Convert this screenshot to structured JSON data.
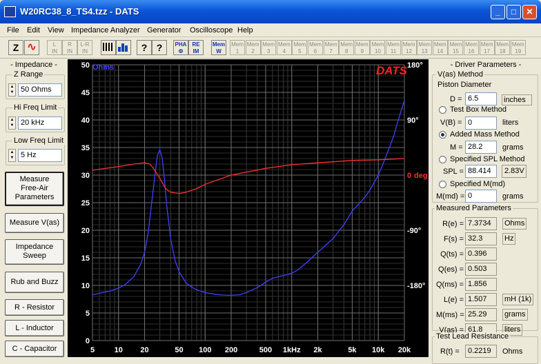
{
  "window": {
    "title": "W20RC38_8_TS4.tzz - DATS",
    "minimize_glyph": "_",
    "maximize_glyph": "□",
    "close_glyph": "✕"
  },
  "menu": [
    "File",
    "Edit",
    "View",
    "Impedance Analyzer",
    "Generator",
    "Oscilloscope",
    "Help"
  ],
  "toolbar": {
    "z_label": "Z",
    "sine_glyph": "∿",
    "trace_buttons": [
      [
        "L",
        "IN"
      ],
      [
        "R",
        "IN"
      ],
      [
        "L-R",
        "IN"
      ]
    ],
    "pha_label": "PHA",
    "pha_sub": "Φ",
    "reim_label": "RE",
    "reim_sub": "IM",
    "mem_label": "Mem",
    "mem_w": "W",
    "mem_slots": [
      "1",
      "2",
      "3",
      "4",
      "5",
      "6",
      "7",
      "8",
      "9",
      "10",
      "11",
      "12",
      "13",
      "14",
      "15",
      "16",
      "17",
      "18",
      "19"
    ],
    "help_glyph": "?",
    "whats_this_glyph": "?"
  },
  "left": {
    "title": "- Impedance -",
    "z_range_label": "Z Range",
    "z_range_value": "50 Ohms",
    "hi_freq_label": "Hi Freq Limit",
    "hi_freq_value": "20 kHz",
    "low_freq_label": "Low Freq Limit",
    "low_freq_value": "5 Hz",
    "buttons": [
      "Measure\nFree-Air\nParameters",
      "Measure V(as)",
      "Impedance\nSweep",
      "Rub and Buzz",
      "R - Resistor",
      "L - Inductor",
      "C - Capacitor"
    ]
  },
  "plot": {
    "brand": "DATS",
    "y_unit": "Ohms",
    "phase_unit": "deg",
    "brand_color": "#ff2020",
    "impedance_color": "#4040ff",
    "phase_color": "#ff3030"
  },
  "chart_data": {
    "type": "line",
    "xlabel": "",
    "ylabel": "Ohms",
    "y2label": "deg",
    "x_scale": "log",
    "xlim": [
      5,
      20000
    ],
    "ylim": [
      0,
      50
    ],
    "y2lim": [
      -270,
      180
    ],
    "grid": true,
    "x_ticks": [
      {
        "v": 5,
        "label": "5"
      },
      {
        "v": 10,
        "label": "10"
      },
      {
        "v": 20,
        "label": "20"
      },
      {
        "v": 50,
        "label": "50"
      },
      {
        "v": 100,
        "label": "100"
      },
      {
        "v": 200,
        "label": "200"
      },
      {
        "v": 500,
        "label": "500"
      },
      {
        "v": 1000,
        "label": "1kHz"
      },
      {
        "v": 2000,
        "label": "2k"
      },
      {
        "v": 5000,
        "label": "5k"
      },
      {
        "v": 10000,
        "label": "10k"
      },
      {
        "v": 20000,
        "label": "20k"
      }
    ],
    "y_ticks": [
      "0",
      "5",
      "10",
      "15",
      "20",
      "25",
      "30",
      "35",
      "40",
      "45",
      "50"
    ],
    "y2_ticks": [
      {
        "v": 180,
        "label": "180°"
      },
      {
        "v": 90,
        "label": "90°"
      },
      {
        "v": 0,
        "label": "0"
      },
      {
        "v": -90,
        "label": "-90°"
      },
      {
        "v": -180,
        "label": "-180°"
      }
    ],
    "series": [
      {
        "name": "",
        "axis": "left",
        "x": [
          5,
          8,
          10,
          12,
          15,
          18,
          20,
          22,
          25,
          28,
          30,
          32,
          34,
          36,
          40,
          45,
          50,
          60,
          70,
          80,
          100,
          130,
          160,
          200,
          250,
          300,
          400,
          500,
          600,
          800,
          1000,
          1200,
          1500,
          2000,
          3000,
          4000,
          5000,
          7000,
          8000,
          10000,
          12000,
          15000,
          17000,
          20000
        ],
        "y": [
          8.3,
          9.0,
          9.5,
          10.2,
          11.6,
          13.8,
          16.0,
          19.5,
          27.0,
          33.5,
          34.6,
          33.0,
          29.0,
          24.5,
          18.5,
          14.5,
          12.5,
          10.5,
          9.7,
          9.2,
          8.7,
          8.4,
          8.25,
          8.2,
          8.3,
          8.7,
          9.6,
          10.6,
          11.3,
          11.8,
          12.2,
          12.9,
          14.2,
          16.0,
          18.5,
          21.0,
          23.5,
          26.0,
          27.3,
          30.0,
          33.0,
          37.0,
          40.0,
          43.5
        ]
      },
      {
        "name": "",
        "axis": "right",
        "x": [
          5,
          10,
          15,
          20,
          23,
          25,
          30,
          35,
          40,
          50,
          60,
          80,
          100,
          200,
          500,
          1000,
          2000,
          5000,
          10000,
          20000
        ],
        "y": [
          8,
          14,
          18,
          20,
          18,
          12,
          -5,
          -22,
          -28,
          -30,
          -28,
          -22,
          -15,
          0,
          11,
          17,
          20,
          24,
          25,
          27
        ]
      }
    ]
  },
  "right": {
    "title": "- Driver Parameters -",
    "vas_method": "V(as) Method",
    "piston_diameter": "Piston Diameter",
    "d_label": "D =",
    "d_value": "6.5",
    "d_unit": "inches",
    "test_box": "Test Box Method",
    "vb_label": "V(B) =",
    "vb_value": "0",
    "vb_unit": "liters",
    "added_mass": "Added Mass Method",
    "m_label": "M =",
    "m_value": "28.2",
    "m_unit": "grams",
    "spec_spl": "Specified SPL Method",
    "spl_label": "SPL =",
    "spl_value": "88.414",
    "spl_volt": "2.83V",
    "spec_mmd": "Specified M(md)",
    "mmd_label": "M(md) =",
    "mmd_value": "0",
    "mmd_unit": "grams",
    "measured_title": "Measured Parameters",
    "params": [
      {
        "label": "R(e) =",
        "value": "7.3734",
        "unit": "Ohms"
      },
      {
        "label": "F(s) =",
        "value": "32.3",
        "unit": "Hz"
      },
      {
        "label": "Q(ts) =",
        "value": "0.396",
        "unit": ""
      },
      {
        "label": "Q(es) =",
        "value": "0.503",
        "unit": ""
      },
      {
        "label": "Q(ms) =",
        "value": "1.856",
        "unit": ""
      },
      {
        "label": "L(e) =",
        "value": "1.507",
        "unit": "mH (1k)"
      },
      {
        "label": "M(ms) =",
        "value": "25.29",
        "unit": "grams"
      },
      {
        "label": "V(as) =",
        "value": "61.8",
        "unit": "liters"
      }
    ],
    "lead_title": "Test Lead Resistance",
    "rt_label": "R(t) =",
    "rt_value": "0.2219",
    "rt_unit": "Ohms"
  }
}
